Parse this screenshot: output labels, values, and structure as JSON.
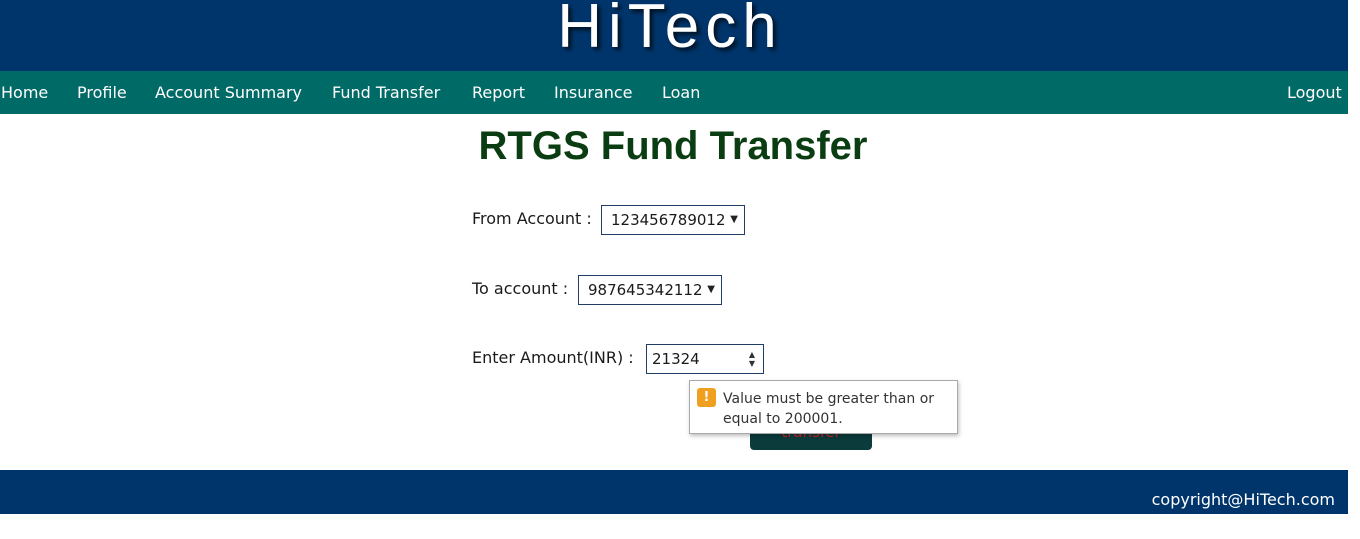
{
  "header": {
    "brand": "HiTech"
  },
  "nav": {
    "items": [
      {
        "label": "Home"
      },
      {
        "label": "Profile"
      },
      {
        "label": "Account Summary"
      },
      {
        "label": "Fund Transfer"
      },
      {
        "label": "Report"
      },
      {
        "label": "Insurance"
      },
      {
        "label": "Loan"
      }
    ],
    "logout": "Logout"
  },
  "page": {
    "title": "RTGS Fund Transfer",
    "from_account_label": "From Account :",
    "from_account_value": "123456789012",
    "to_account_label": "To account :",
    "to_account_value": "987645342112",
    "amount_label": "Enter Amount(INR) :",
    "amount_value": "21324",
    "transfer_button": "transfer",
    "validation_message": "Value must be greater than or equal to 200001.",
    "validation_icon": "!"
  },
  "footer": {
    "copyright": "copyright@HiTech.com"
  },
  "colors": {
    "header_bg": "#00356b",
    "nav_bg": "#006a66",
    "title": "#0b3d12",
    "warning": "#f0a020"
  },
  "icons": {
    "warning": "warning-icon",
    "dropdown": "chevron-down-icon",
    "spinner": "spinner-icon"
  }
}
